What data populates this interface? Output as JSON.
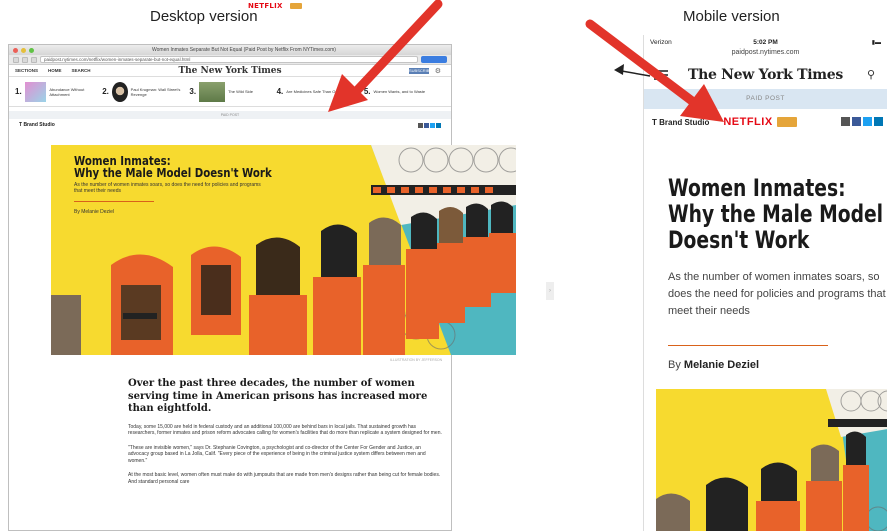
{
  "captions": {
    "desktop": "Desktop version",
    "mobile": "Mobile version"
  },
  "desktop": {
    "window_title": "Women Inmates Separate But Not Equal (Paid Post by Netflix From NYTimes.com)",
    "url": "paidpost.nytimes.com/netflix/women-inmates-separate-but-not-equal.html",
    "sections_label": "SECTIONS",
    "home_label": "HOME",
    "search_label": "SEARCH",
    "masthead": "The New York Times",
    "subscribe_label": "SUBSCRIBE",
    "strip": [
      {
        "num": "1.",
        "text": "Abundance Without Attachment"
      },
      {
        "num": "2.",
        "text": "Paul Krugman: Wall Street's Revenge"
      },
      {
        "num": "3.",
        "text": "The Wild Side"
      },
      {
        "num": "4.",
        "text": "Are Medicines Safe Than Owned?"
      },
      {
        "num": "5.",
        "text": "Women Wants, and to Waste"
      }
    ],
    "paid_post": "PAID POST",
    "brand_studio": "T Brand Studio",
    "netflix": "NETFLIX",
    "hero": {
      "title_line1": "Women Inmates:",
      "title_line2": "Why the Male Model Doesn't Work",
      "subtitle": "As the number of women inmates soars, so does the need for policies and programs that meet their needs",
      "byline": "By Melanie Deziel",
      "photo_credit": "ILLUSTRATION BY JEFFERSON"
    },
    "lede": "Over the past three decades, the number of women serving time in American prisons has increased more than eightfold.",
    "paragraphs": [
      "Today, some 15,000 are held in federal custody and an additional 100,000 are behind bars in local jails. That sustained growth has researchers, former inmates and prison reform advocates calling for women's facilities that do more than replicate a system designed for men.",
      "\"These are invisible women,\" says Dr. Stephanie Covington, a psychologist and co-director of the Center For Gender and Justice, an advocacy group based in La Jolla, Calif. \"Every piece of the experience of being in the criminal justice system differs between men and women.\"",
      "At the most basic level, women often must make do with jumpsuits that are made from men's designs rather than being cut for female bodies. And standard personal care"
    ]
  },
  "mobile": {
    "carrier": "Verizon",
    "time": "5:02 PM",
    "url": "paidpost.nytimes.com",
    "masthead": "The New York Times",
    "paid_post": "PAID POST",
    "brand_studio": "T Brand Studio",
    "netflix": "NETFLIX",
    "title": "Women Inmates: Why the Male Model Doesn't Work",
    "title_l1": "Women Inmates:",
    "title_l2": "Why the Male Model",
    "title_l3": "Doesn't Work",
    "subtitle": "As the number of women inmates soars, so does the need for policies and programs that meet their needs",
    "byline_prefix": "By",
    "byline_name": "Melanie Deziel"
  },
  "colors": {
    "arrow": "#e2342a",
    "hero_yellow": "#f7da2f",
    "hero_orange": "#e8622a",
    "hero_teal": "#4fb7c0",
    "netflix_red": "#e50914",
    "paid_bar": "#d9e6f2"
  }
}
